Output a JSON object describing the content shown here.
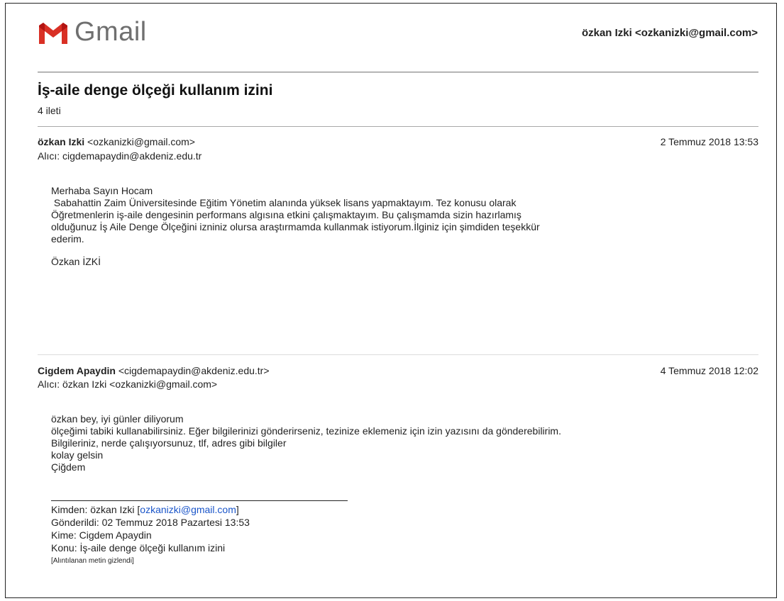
{
  "header": {
    "logo_text": "Gmail",
    "account": "özkan Izki <ozkanizki@gmail.com>",
    "colors": {
      "logo_red": "#d93025",
      "logo_dark_red": "#b31412"
    }
  },
  "thread": {
    "subject": "İş-aile denge ölçeği kullanım izini",
    "count": "4 ileti"
  },
  "messages": [
    {
      "sender_name": "özkan Izki",
      "sender_email": "<ozkanizki@gmail.com>",
      "date": "2 Temmuz 2018 13:53",
      "to": "Alıcı: cigdemapaydin@akdeniz.edu.tr",
      "body": [
        "Merhaba Sayın Hocam",
        " Sabahattin Zaim Üniversitesinde Eğitim Yönetim alanında yüksek lisans yapmaktayım. Tez konusu olarak",
        "Öğretmenlerin iş-aile dengesinin performans algısına etkini çalışmaktayım. Bu çalışmamda sizin hazırlamış",
        "olduğunuz İş Aile Denge Ölçeğini izniniz olursa araştırmamda kullanmak istiyorum.İlginiz için şimdiden teşekkür",
        "ederim.",
        "Özkan İZKİ"
      ]
    },
    {
      "sender_name": "Cigdem Apaydin",
      "sender_email": "<cigdemapaydin@akdeniz.edu.tr>",
      "date": "4 Temmuz 2018 12:02",
      "to": "Alıcı: özkan Izki <ozkanizki@gmail.com>",
      "body": [
        "özkan bey, iyi günler diliyorum",
        "ölçeğimi tabiki kullanabilirsiniz. Eğer bilgilerinizi gönderirseniz, tezinize eklemeniz için izin yazısını da gönderebilirim.",
        "Bilgileriniz, nerde çalışıyorsunuz, tlf, adres gibi bilgiler",
        "kolay gelsin",
        "Çiğdem"
      ],
      "quoted": {
        "from_prefix": "Kimden: özkan Izki [",
        "from_email": "ozkanizki@gmail.com",
        "from_suffix": "]",
        "sent": "Gönderildi: 02 Temmuz 2018 Pazartesi 13:53",
        "to": "Kime: Cigdem Apaydin",
        "subject": "Konu: İş-aile denge ölçeği kullanım izini",
        "hidden_note": "[Alıntılanan metin gizlendi]"
      }
    }
  ]
}
